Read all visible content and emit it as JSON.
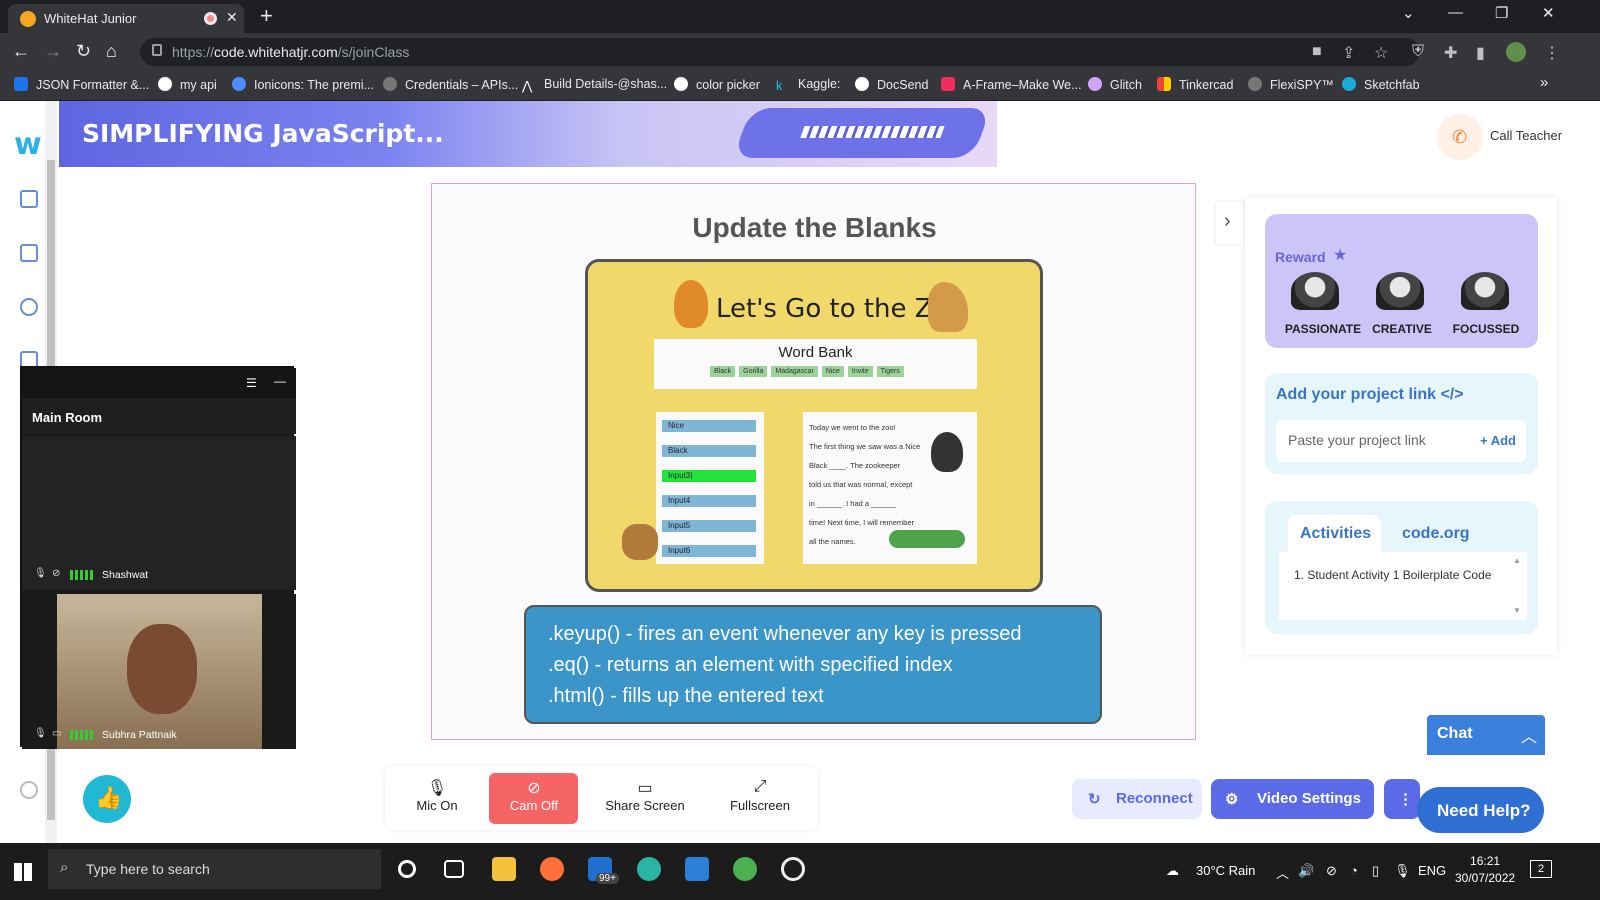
{
  "browser": {
    "tab_title": "WhiteHat Junior",
    "new_tab": "+",
    "url_prefix": "https://",
    "url_domain": "code.whitehatjr.com",
    "url_path": "/s/joinClass",
    "bookmarks": [
      "JSON Formatter &...",
      "my api",
      "Ionicons: The premi...",
      "Credentials – APIs...",
      "Build Details-@shas...",
      "color picker",
      "Kaggle:",
      "DocSend",
      "A-Frame–Make We...",
      "Glitch",
      "Tinkercad",
      "FlexiSPY™",
      "Sketchfab"
    ],
    "bookmarks_more": "»"
  },
  "header": {
    "banner_title": "SIMPLIFYING JavaScript...",
    "call_teacher": "Call Teacher"
  },
  "slide": {
    "title": "Update the Blanks",
    "zoo_title": "Let's Go to the Zoo",
    "word_bank_title": "Word Bank",
    "word_bank": [
      "Black",
      "Gorilla",
      "Madagascar",
      "Nice",
      "Invite",
      "Tigers"
    ],
    "inputs": [
      "Nice",
      "Black",
      "Input3|",
      "Input4",
      "Input5",
      "Input6"
    ],
    "story_lines": [
      "Today we went to the zoo!",
      "The first thing we saw was a Nice",
      "Black ____. The zookeeper",
      "told us that was normal, except",
      "in ______. I had a ______",
      "time! Next time, I will remember",
      "all the names."
    ],
    "methods": [
      ".keyup() - fires an event whenever any key is pressed",
      ".eq() - returns an element with specified index",
      ".html() - fills up the entered text"
    ]
  },
  "right_panel": {
    "reward_label": "Reward",
    "rewards": [
      "PASSIONATE",
      "CREATIVE",
      "FOCUSSED"
    ],
    "project_link_title": "Add your project link </>",
    "project_link_placeholder": "Paste your project link",
    "add_label": "+ Add",
    "tabs": [
      "Activities",
      "code.org"
    ],
    "activities": [
      "1. Student Activity 1 Boilerplate Code"
    ]
  },
  "video": {
    "room": "Main Room",
    "participants": [
      "Shashwat",
      "Subhra Pattnaik"
    ]
  },
  "controls": {
    "mic": "Mic On",
    "cam": "Cam Off",
    "share": "Share Screen",
    "fullscreen": "Fullscreen",
    "reconnect": "Reconnect",
    "video_settings": "Video Settings",
    "chat": "Chat",
    "help": "Need Help?"
  },
  "taskbar": {
    "search_placeholder": "Type here to search",
    "badge": "99+",
    "weather": "30°C  Rain",
    "lang": "ENG",
    "time": "16:21",
    "date": "30/07/2022",
    "notif_count": "2"
  },
  "colors": {
    "accent": "#5b6ae6",
    "cam_off": "#f56565",
    "slide_blue": "#3b95c8"
  }
}
